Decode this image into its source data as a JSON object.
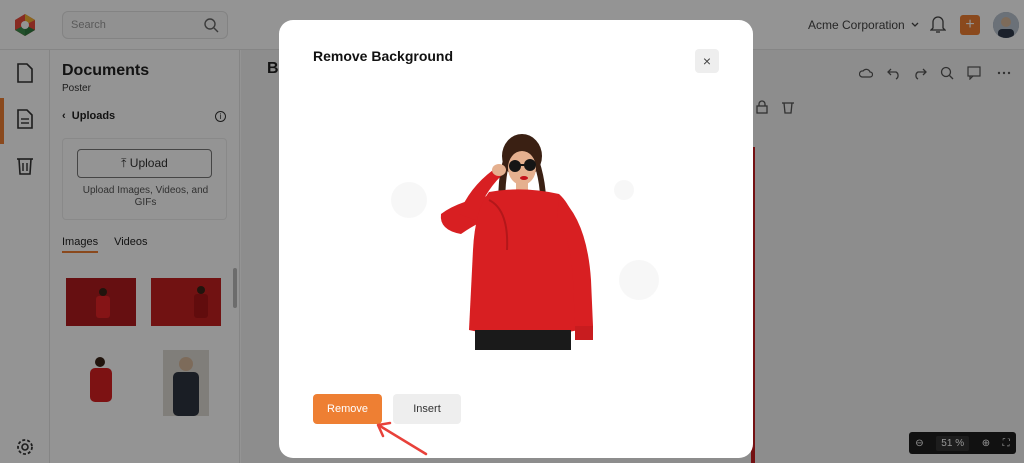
{
  "header": {
    "search_placeholder": "Search",
    "company": "Acme Corporation"
  },
  "panel": {
    "title": "Documents",
    "subtitle": "Poster",
    "section": "Uploads",
    "upload_label": "Upload",
    "upload_hint": "Upload Images, Videos, and GIFs",
    "tabs": [
      "Images",
      "Videos"
    ]
  },
  "canvas": {
    "doc_initial": "B",
    "zoom_value": "51",
    "zoom_unit": "%"
  },
  "modal": {
    "title": "Remove Background",
    "close": "×",
    "remove_label": "Remove",
    "insert_label": "Insert"
  },
  "colors": {
    "accent": "#ee7f33",
    "sweater": "#d81f22"
  }
}
